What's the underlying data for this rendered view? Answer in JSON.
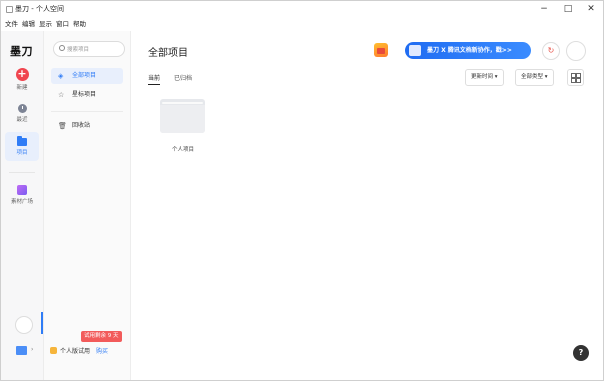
{
  "window": {
    "title": "墨刀 - 个人空间",
    "controls": {
      "minimize": "−",
      "maximize": "□",
      "close": "✕"
    },
    "menu": [
      "文件",
      "编辑",
      "显示",
      "窗口",
      "帮助"
    ]
  },
  "rail": {
    "logo": "墨刀",
    "items": [
      {
        "label": "新建",
        "icon": "plus-icon"
      },
      {
        "label": "最近",
        "icon": "clock-icon"
      },
      {
        "label": "项目",
        "icon": "folder-icon",
        "active": true
      },
      {
        "label": "素材广场",
        "icon": "material-icon"
      }
    ]
  },
  "sidebar": {
    "search_placeholder": "搜索项目",
    "items": [
      {
        "label": "全部项目",
        "icon": "layers-icon",
        "active": true
      },
      {
        "label": "星标项目",
        "icon": "star-icon"
      },
      {
        "label": "回收站",
        "icon": "trash-icon"
      }
    ],
    "trial_badge": "试用剩余 9 天",
    "plan_label": "个人版试用",
    "buy_label": "购买"
  },
  "main": {
    "heading": "全部项目",
    "tabs": [
      {
        "label": "当前",
        "active": true
      },
      {
        "label": "已归档"
      }
    ],
    "promo_text": "墨刀 X 腾讯文档新协作，戳>>",
    "sort_label": "更新时间 ▾",
    "type_label": "全部类型 ▾",
    "projects": [
      {
        "name": "个人项目"
      }
    ],
    "help_label": "?"
  },
  "colors": {
    "accent": "#2f7cf6",
    "new_button": "#f0454f",
    "trial_badge": "#f25b5b"
  }
}
